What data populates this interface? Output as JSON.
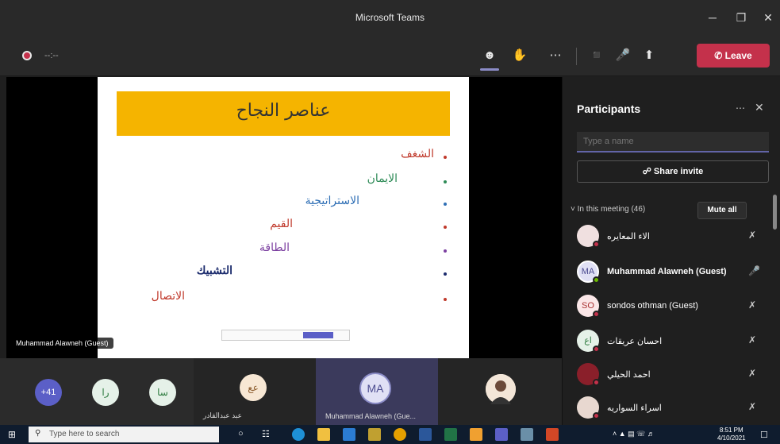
{
  "window": {
    "title": "Microsoft Teams"
  },
  "toolbar": {
    "timer": "--:--",
    "leave_label": "Leave"
  },
  "slide": {
    "title": "عناصر النجاح",
    "bullets": [
      {
        "text": "الشغف",
        "color": "#c0392b"
      },
      {
        "text": "الايمان",
        "color": "#2e8b57"
      },
      {
        "text": "الاستراتيجية",
        "color": "#2f6fb5"
      },
      {
        "text": "القيم",
        "color": "#c0392b"
      },
      {
        "text": "الطاقة",
        "color": "#7b3fa0"
      },
      {
        "text": "التشبيك",
        "color": "#1a2a6c"
      },
      {
        "text": "الاتصال",
        "color": "#c0392b"
      }
    ]
  },
  "stage": {
    "presenter_label": "Muhammad Alawneh (Guest)"
  },
  "gallery": {
    "overflow_count": "+41",
    "tiles": [
      {
        "initials": "را"
      },
      {
        "initials": "سا"
      },
      {
        "initials": "عع",
        "label": "عبد عبدالقادر"
      },
      {
        "initials": "MA",
        "label": "Muhammad Alawneh (Gue..."
      },
      {
        "initials": ""
      }
    ]
  },
  "participants": {
    "title": "Participants",
    "search_placeholder": "Type a name",
    "share_invite_label": "Share invite",
    "meeting_heading": "In this meeting (46)",
    "mute_all_label": "Mute all",
    "list": [
      {
        "name": "الاء المعايره",
        "initials": "",
        "mic": "muted"
      },
      {
        "name": "Muhammad Alawneh (Guest)",
        "initials": "MA",
        "mic": "on"
      },
      {
        "name": "sondos othman (Guest)",
        "initials": "SO",
        "mic": "muted"
      },
      {
        "name": "احسان عريقات",
        "initials": "اع",
        "mic": "muted"
      },
      {
        "name": "احمد الحيلي",
        "initials": "",
        "mic": "muted"
      },
      {
        "name": "اسراء السواريه",
        "initials": "",
        "mic": "muted"
      }
    ]
  },
  "taskbar": {
    "search_placeholder": "Type here to search",
    "time": "8:51 PM",
    "date": "4/10/2021"
  }
}
